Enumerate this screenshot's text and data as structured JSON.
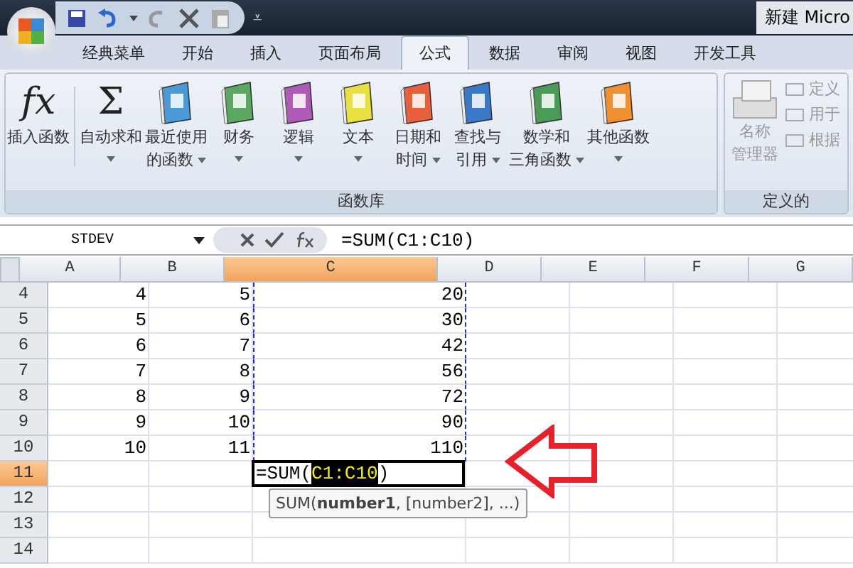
{
  "window": {
    "title": "新建 Micro"
  },
  "quick_access": {
    "menu_glyph": "⩡"
  },
  "tabs": [
    {
      "label": "经典菜单",
      "selected": false
    },
    {
      "label": "开始",
      "selected": false
    },
    {
      "label": "插入",
      "selected": false
    },
    {
      "label": "页面布局",
      "selected": false
    },
    {
      "label": "公式",
      "selected": true
    },
    {
      "label": "数据",
      "selected": false
    },
    {
      "label": "审阅",
      "selected": false
    },
    {
      "label": "视图",
      "selected": false
    },
    {
      "label": "开发工具",
      "selected": false
    }
  ],
  "ribbon": {
    "groups": [
      {
        "label": "函数库",
        "buttons": [
          {
            "kind": "glyph",
            "glyph": "fx",
            "lines": [
              "插入函数"
            ],
            "dropdown": false
          },
          {
            "kind": "glyph",
            "glyph": "Σ",
            "lines": [
              "自动求和"
            ],
            "dropdown": true
          },
          {
            "kind": "book",
            "color": "#4a9ad8",
            "lines": [
              "最近使用",
              "的函数"
            ],
            "dropdown": true
          },
          {
            "kind": "book",
            "color": "#5aa860",
            "lines": [
              "财务"
            ],
            "dropdown": true
          },
          {
            "kind": "book",
            "color": "#b05ab8",
            "lines": [
              "逻辑"
            ],
            "dropdown": true
          },
          {
            "kind": "book",
            "color": "#e8e040",
            "lines": [
              "文本"
            ],
            "dropdown": true
          },
          {
            "kind": "book",
            "color": "#e8603a",
            "lines": [
              "日期和",
              "时间"
            ],
            "dropdown": true
          },
          {
            "kind": "book",
            "color": "#3a78c8",
            "lines": [
              "查找与",
              "引用"
            ],
            "dropdown": true
          },
          {
            "kind": "book",
            "color": "#4a9a58",
            "lines": [
              "数学和",
              "三角函数"
            ],
            "dropdown": true
          },
          {
            "kind": "book",
            "color": "#f09030",
            "lines": [
              "其他函数"
            ],
            "dropdown": true
          }
        ]
      },
      {
        "label": "定义的",
        "disabled": true,
        "big_button": {
          "lines": [
            "名称",
            "管理器"
          ]
        },
        "small_buttons": [
          "定义",
          "用于",
          "根据"
        ]
      }
    ]
  },
  "formula_bar": {
    "name_box": "STDEV",
    "formula": "=SUM(C1:C10)"
  },
  "sheet": {
    "columns": [
      {
        "label": "A",
        "selected": false
      },
      {
        "label": "B",
        "selected": false
      },
      {
        "label": "C",
        "selected": true
      },
      {
        "label": "D",
        "selected": false
      },
      {
        "label": "E",
        "selected": false
      },
      {
        "label": "F",
        "selected": false
      },
      {
        "label": "G",
        "selected": false
      }
    ],
    "rows": [
      {
        "header": "4",
        "selected": false,
        "editing": false,
        "cells": [
          "4",
          "5",
          "20"
        ]
      },
      {
        "header": "5",
        "selected": false,
        "editing": false,
        "cells": [
          "5",
          "6",
          "30"
        ]
      },
      {
        "header": "6",
        "selected": false,
        "editing": false,
        "cells": [
          "6",
          "7",
          "42"
        ]
      },
      {
        "header": "7",
        "selected": false,
        "editing": false,
        "cells": [
          "7",
          "8",
          "56"
        ]
      },
      {
        "header": "8",
        "selected": false,
        "editing": false,
        "cells": [
          "8",
          "9",
          "72"
        ]
      },
      {
        "header": "9",
        "selected": false,
        "editing": false,
        "cells": [
          "9",
          "10",
          "90"
        ]
      },
      {
        "header": "10",
        "selected": false,
        "editing": false,
        "cells": [
          "10",
          "11",
          "110"
        ]
      },
      {
        "header": "11",
        "selected": true,
        "editing": true,
        "cells": []
      },
      {
        "header": "12",
        "selected": false,
        "editing": false,
        "cells": []
      },
      {
        "header": "13",
        "selected": false,
        "editing": false,
        "cells": []
      },
      {
        "header": "14",
        "selected": false,
        "editing": false,
        "cells": []
      }
    ],
    "editor": {
      "prefix": "=SUM(",
      "reference": "C1:C10",
      "suffix": ")"
    },
    "tooltip": "SUM(**number1**, [number2], ...)"
  }
}
